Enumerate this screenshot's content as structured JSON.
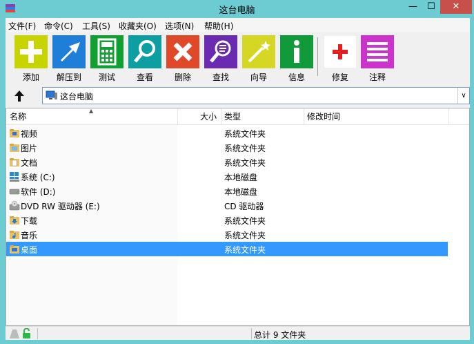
{
  "window": {
    "title": "这台电脑",
    "minimize_glyph": "—",
    "maximize_glyph": "☐",
    "close_glyph": "✕"
  },
  "menu": {
    "items": [
      {
        "label": "文件(F)"
      },
      {
        "label": "命令(C)"
      },
      {
        "label": "工具(S)"
      },
      {
        "label": "收藏夹(O)"
      },
      {
        "label": "选项(N)"
      },
      {
        "label": "帮助(H)"
      }
    ]
  },
  "toolbar": {
    "tools": [
      {
        "label": "添加",
        "icon": "plus-icon",
        "color": "#c8d400"
      },
      {
        "label": "解压到",
        "icon": "extract-arrow-icon",
        "color": "#1f7ed8"
      },
      {
        "label": "测试",
        "icon": "calculator-icon",
        "color": "#10a030"
      },
      {
        "label": "查看",
        "icon": "magnifier-icon",
        "color": "#0c9ea0"
      },
      {
        "label": "删除",
        "icon": "delete-x-icon",
        "color": "#e0482a"
      },
      {
        "label": "查找",
        "icon": "find-icon",
        "color": "#6a2bb0"
      },
      {
        "label": "向导",
        "icon": "wand-icon",
        "color": "#d6d624"
      },
      {
        "label": "信息",
        "icon": "info-icon",
        "color": "#109a3a"
      },
      {
        "label": "修复",
        "icon": "red-cross-icon",
        "color": "#ffffff"
      },
      {
        "label": "注释",
        "icon": "comment-lines-icon",
        "color": "#cc33cc"
      }
    ]
  },
  "address": {
    "path": "这台电脑",
    "up_icon": "up-arrow-icon",
    "dropdown_glyph": "∨"
  },
  "list": {
    "columns": [
      {
        "label": "名称"
      },
      {
        "label": "大小"
      },
      {
        "label": "类型"
      },
      {
        "label": "修改时间"
      }
    ],
    "rows": [
      {
        "name": "视频",
        "type": "系统文件夹",
        "icon": "video-folder-icon"
      },
      {
        "name": "图片",
        "type": "系统文件夹",
        "icon": "pictures-folder-icon"
      },
      {
        "name": "文档",
        "type": "系统文件夹",
        "icon": "documents-folder-icon"
      },
      {
        "name": "系统 (C:)",
        "type": "本地磁盘",
        "icon": "windows-drive-icon"
      },
      {
        "name": "软件 (D:)",
        "type": "本地磁盘",
        "icon": "drive-icon"
      },
      {
        "name": "DVD RW 驱动器 (E:)",
        "type": "CD 驱动器",
        "icon": "dvd-drive-icon"
      },
      {
        "name": "下载",
        "type": "系统文件夹",
        "icon": "downloads-folder-icon"
      },
      {
        "name": "音乐",
        "type": "系统文件夹",
        "icon": "music-folder-icon"
      },
      {
        "name": "桌面",
        "type": "系统文件夹",
        "icon": "desktop-folder-icon",
        "selected": true
      }
    ]
  },
  "status": {
    "summary": "总计 9 文件夹"
  },
  "colors": {
    "titlebar": "#6dccd2",
    "close": "#c7504a",
    "selection": "#3399ff"
  }
}
